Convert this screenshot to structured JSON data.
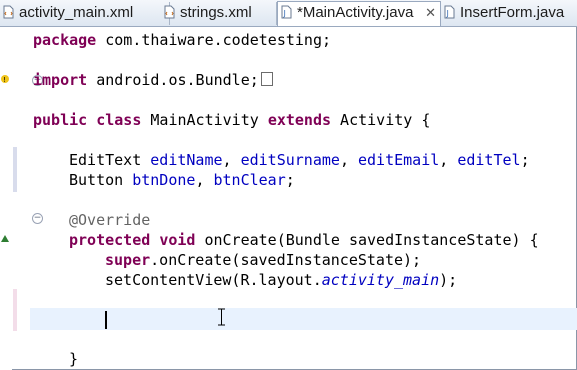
{
  "tabs": [
    {
      "label": "activity_main.xml",
      "icon": "xml-file-icon",
      "active": false
    },
    {
      "label": "strings.xml",
      "icon": "xml-file-icon",
      "active": false
    },
    {
      "label": "*MainActivity.java",
      "icon": "java-file-icon",
      "active": true,
      "close": "✕"
    },
    {
      "label": "InsertForm.java",
      "icon": "java-file-icon",
      "active": false
    }
  ],
  "code": {
    "l1": {
      "kw": "package",
      "rest": " com.thaiware.codetesting;"
    },
    "l2": {
      "kw": "import",
      "rest": " android.os.Bundle;"
    },
    "l3": {
      "kw1": "public",
      "kw2": "class",
      "name": " MainActivity ",
      "kw3": "extends",
      "rest": " Activity {"
    },
    "l4": {
      "type": "EditText ",
      "f1": "editName",
      "s1": ", ",
      "f2": "editSurname",
      "s2": ", ",
      "f3": "editEmail",
      "s3": ", ",
      "f4": "editTel",
      "end": ";"
    },
    "l5": {
      "type": "Button ",
      "f1": "btnDone",
      "s1": ", ",
      "f2": "btnClear",
      "end": ";"
    },
    "l6": {
      "ann": "@Override"
    },
    "l7": {
      "kw1": "protected",
      "kw2": "void",
      "rest": " onCreate(Bundle savedInstanceState) {"
    },
    "l8": {
      "kw": "super",
      "rest": ".onCreate(savedInstanceState);"
    },
    "l9": {
      "pre": "setContentView(R.layout.",
      "ital": "activity_main",
      "post": ");"
    },
    "l10": {
      "text": "}"
    }
  },
  "colors": {
    "keyword": "#7f0055",
    "field": "#0000c0",
    "annotation": "#646464",
    "current_line": "#e8f2fe"
  }
}
